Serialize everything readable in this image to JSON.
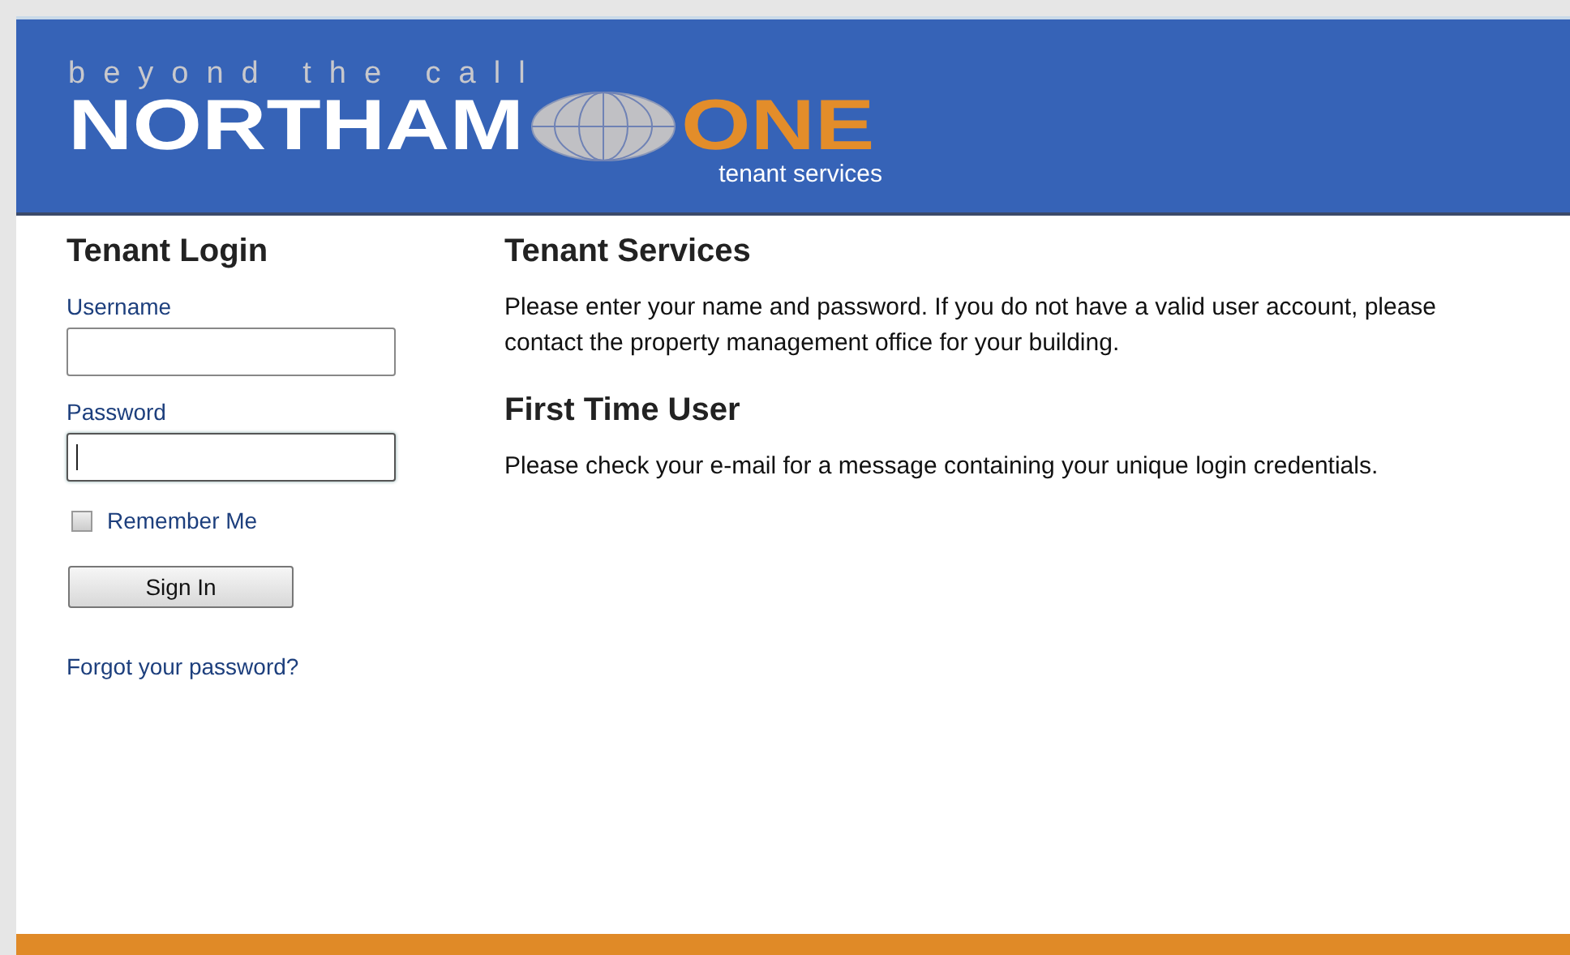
{
  "header": {
    "tagline": "beyond the call",
    "brand_left": "NORTHAM",
    "brand_right": "ONE",
    "subtitle": "tenant services"
  },
  "login": {
    "title": "Tenant Login",
    "fields": [
      {
        "label": "Username",
        "focused": false
      },
      {
        "label": "Password",
        "focused": true
      }
    ],
    "remember": {
      "label": "Remember Me",
      "checked": false
    },
    "button": "Sign In",
    "forgot_link": "Forgot your password?"
  },
  "sections": [
    {
      "heading": "Tenant Services",
      "text": "Please enter your name and password. If you do not have a valid user account, please contact the property management office for your building."
    },
    {
      "heading": "First Time User",
      "text": "Please check your e-mail for a message containing your unique login credentials."
    }
  ]
}
